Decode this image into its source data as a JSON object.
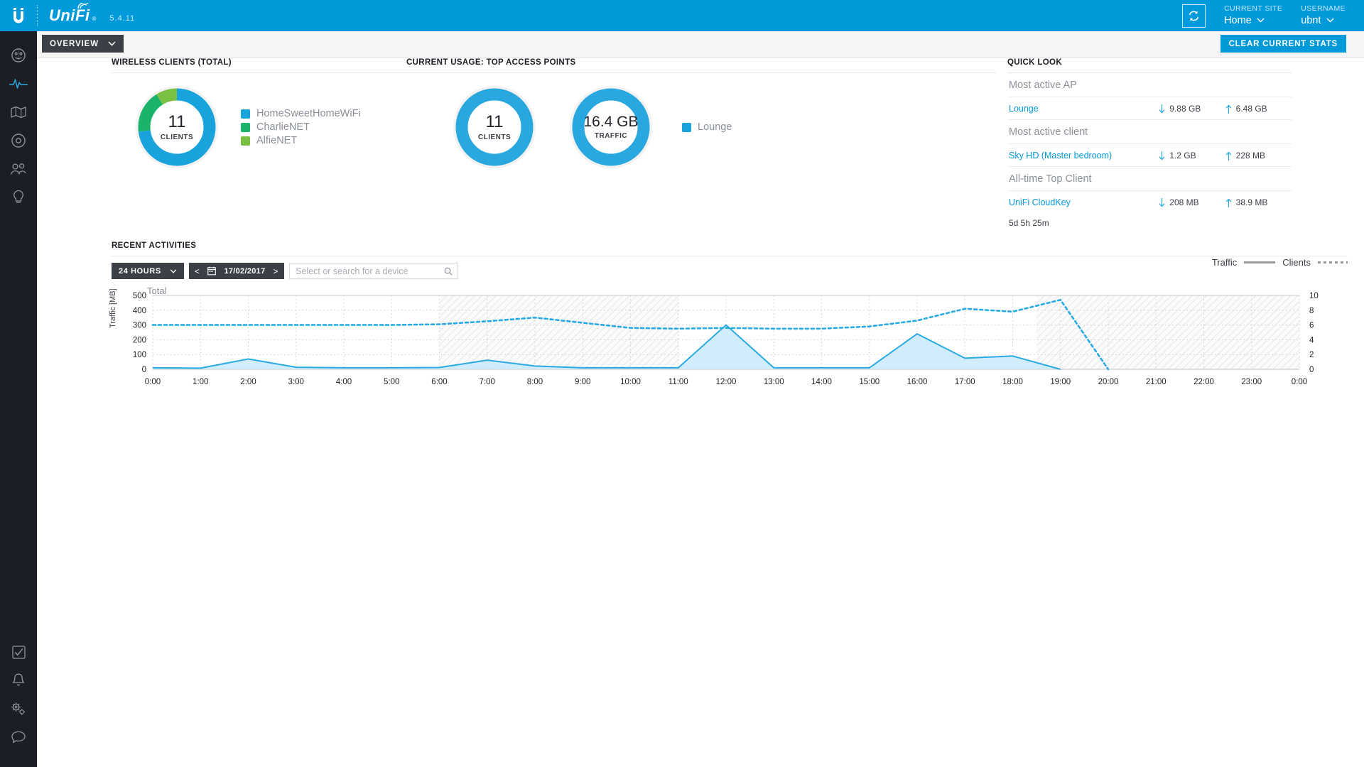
{
  "header": {
    "brand": "UniFi",
    "brand_reg": "®",
    "version": "5.4.11",
    "refresh_icon": "refresh-icon",
    "current_site_label": "CURRENT SITE",
    "current_site_value": "Home",
    "username_label": "USERNAME",
    "username_value": "ubnt"
  },
  "subbar": {
    "overview_label": "OVERVIEW",
    "clear_stats_label": "CLEAR CURRENT STATS"
  },
  "sidebar": {
    "top_items": [
      {
        "name": "dashboard-icon",
        "label": "Dashboard",
        "active": false
      },
      {
        "name": "statistics-icon",
        "label": "Statistics",
        "active": true
      },
      {
        "name": "map-icon",
        "label": "Map",
        "active": false
      },
      {
        "name": "devices-icon",
        "label": "Devices",
        "active": false
      },
      {
        "name": "clients-icon",
        "label": "Clients",
        "active": false
      },
      {
        "name": "insights-icon",
        "label": "Insights",
        "active": false
      }
    ],
    "bottom_items": [
      {
        "name": "tasks-icon",
        "label": "Tasks"
      },
      {
        "name": "alerts-icon",
        "label": "Alerts"
      },
      {
        "name": "settings-icon",
        "label": "Settings"
      },
      {
        "name": "chat-icon",
        "label": "Chat"
      }
    ]
  },
  "wireless_clients": {
    "title": "WIRELESS CLIENTS (TOTAL)",
    "center_value": "11",
    "center_label": "CLIENTS",
    "legend": [
      {
        "label": "HomeSweetHomeWiFi",
        "color": "#19a3dd"
      },
      {
        "label": "CharlieNET",
        "color": "#19b369"
      },
      {
        "label": "AlfieNET",
        "color": "#7ac143"
      }
    ]
  },
  "current_usage": {
    "title": "CURRENT USAGE: TOP ACCESS POINTS",
    "clients_value": "11",
    "clients_label": "CLIENTS",
    "traffic_value": "16.4 GB",
    "traffic_label": "TRAFFIC",
    "legend": [
      {
        "label": "Lounge",
        "color": "#19a3dd"
      }
    ]
  },
  "quick_look": {
    "title": "QUICK LOOK",
    "groups": [
      {
        "heading": "Most active AP",
        "name": "Lounge",
        "down": "9.88 GB",
        "up": "6.48 GB",
        "sub": ""
      },
      {
        "heading": "Most active client",
        "name": "Sky HD (Master bedroom)",
        "down": "1.2 GB",
        "up": "228 MB",
        "sub": ""
      },
      {
        "heading": "All-time Top Client",
        "name": "UniFi CloudKey",
        "down": "208 MB",
        "up": "38.9 MB",
        "sub": "5d 5h 25m"
      }
    ]
  },
  "recent_activities": {
    "title": "RECENT ACTIVITIES",
    "period_label": "24 HOURS",
    "prev_label": "<",
    "next_label": ">",
    "date_value": "17/02/2017",
    "calendar_icon": "calendar-icon",
    "search_placeholder": "Select or search for a device",
    "search_value": "",
    "search_icon": "search-icon",
    "legend_traffic": "Traffic",
    "legend_clients": "Clients"
  },
  "chart_data": {
    "type": "area",
    "title": "Total",
    "xlabel": "",
    "ylabel": "Traffic [MB]",
    "y2label": "",
    "ylim": [
      0,
      500
    ],
    "y2lim": [
      0,
      10
    ],
    "yticks": [
      0,
      100,
      200,
      300,
      400,
      500
    ],
    "y2ticks": [
      0,
      2,
      4,
      6,
      8,
      10
    ],
    "grid": true,
    "legend_position": "top-right",
    "x": [
      "0:00",
      "1:00",
      "2:00",
      "3:00",
      "4:00",
      "5:00",
      "6:00",
      "7:00",
      "8:00",
      "9:00",
      "10:00",
      "11:00",
      "12:00",
      "13:00",
      "14:00",
      "15:00",
      "16:00",
      "17:00",
      "18:00",
      "19:00",
      "20:00",
      "21:00",
      "22:00",
      "23:00",
      "0:00"
    ],
    "xticks": [
      "0:00",
      "1:00",
      "2:00",
      "3:00",
      "4:00",
      "5:00",
      "6:00",
      "7:00",
      "8:00",
      "9:00",
      "10:00",
      "11:00",
      "12:00",
      "13:00",
      "14:00",
      "15:00",
      "16:00",
      "17:00",
      "18:00",
      "19:00",
      "20:00",
      "21:00",
      "22:00",
      "23:00",
      "0:00"
    ],
    "series": [
      {
        "name": "Traffic",
        "style": "area-solid",
        "color": "#29abe2",
        "fill": "#c9e9f9",
        "axis": "left",
        "units": "MB",
        "values": [
          10,
          8,
          70,
          14,
          10,
          10,
          12,
          62,
          22,
          10,
          10,
          10,
          300,
          10,
          10,
          10,
          240,
          75,
          90,
          0
        ]
      },
      {
        "name": "Clients",
        "style": "line-dotted",
        "color": "#29abe2",
        "axis": "right",
        "units": "clients",
        "values": [
          6,
          6,
          6,
          6,
          6,
          6,
          6.1,
          6.5,
          7.0,
          6.3,
          5.6,
          5.5,
          5.6,
          5.5,
          5.5,
          5.8,
          6.6,
          8.2,
          7.8,
          9.4,
          0
        ]
      }
    ],
    "shaded_bands": [
      {
        "from": "6:00",
        "to": "11:00"
      },
      {
        "from": "18:30",
        "to": "0:00"
      }
    ]
  }
}
